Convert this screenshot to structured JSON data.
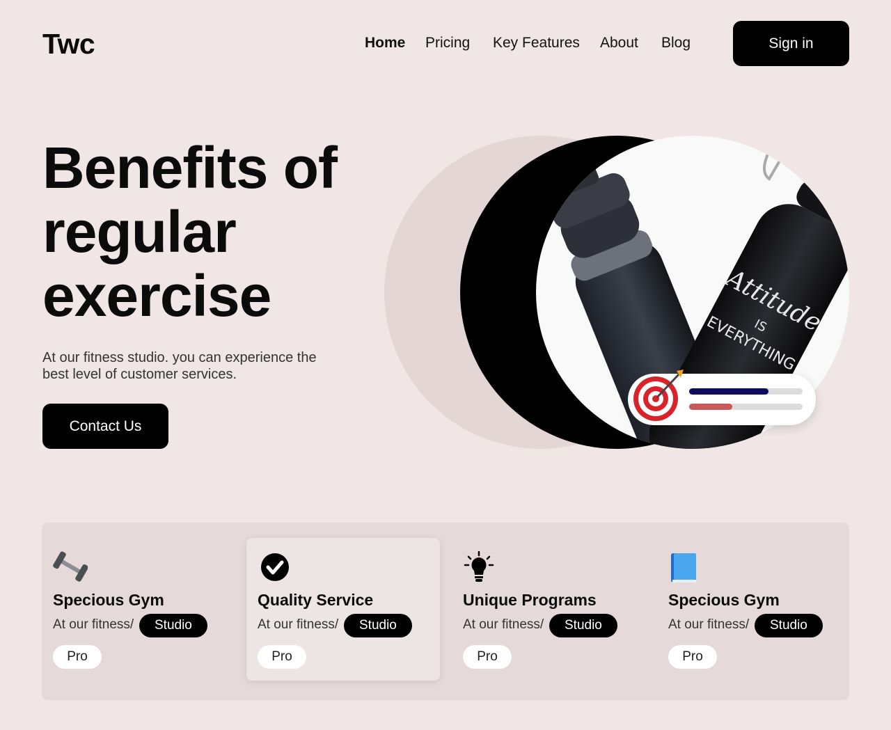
{
  "brand": {
    "logo": "Twc"
  },
  "nav": {
    "items": [
      {
        "label": "Home",
        "active": true
      },
      {
        "label": "Pricing"
      },
      {
        "label": "Key Features"
      },
      {
        "label": "About"
      },
      {
        "label": "Blog"
      }
    ],
    "signin_label": "Sign in"
  },
  "hero": {
    "title_lines": [
      "Benefits of",
      "regular",
      "exercise"
    ],
    "subtitle": "At our fitness studio. you can experience the best level of customer services.",
    "cta_label": "Contact Us",
    "progress": [
      {
        "name": "primary",
        "value": 0.7,
        "color": "#0f0c5e"
      },
      {
        "name": "secondary",
        "value": 0.38,
        "color": "#c9585a"
      }
    ],
    "bottle_text": [
      "Attitude",
      "IS",
      "EVERYTHING"
    ]
  },
  "features": [
    {
      "icon": "dumbbell-icon",
      "title": "Specious Gym",
      "desc": "At our fitness/",
      "tag": "Studio",
      "level": "Pro",
      "highlight": false
    },
    {
      "icon": "check-circle-icon",
      "title": "Quality Service",
      "desc": "At our fitness/",
      "tag": "Studio",
      "level": "Pro",
      "highlight": true
    },
    {
      "icon": "lightbulb-icon",
      "title": "Unique Programs",
      "desc": "At our fitness/",
      "tag": "Studio",
      "level": "Pro",
      "highlight": false
    },
    {
      "icon": "book-icon",
      "title": "Specious Gym",
      "desc": "At our fitness/",
      "tag": "Studio",
      "level": "Pro",
      "highlight": false
    }
  ],
  "colors": {
    "background": "#efe6e5",
    "panel": "#e6d9d9",
    "accent": "#000000"
  }
}
